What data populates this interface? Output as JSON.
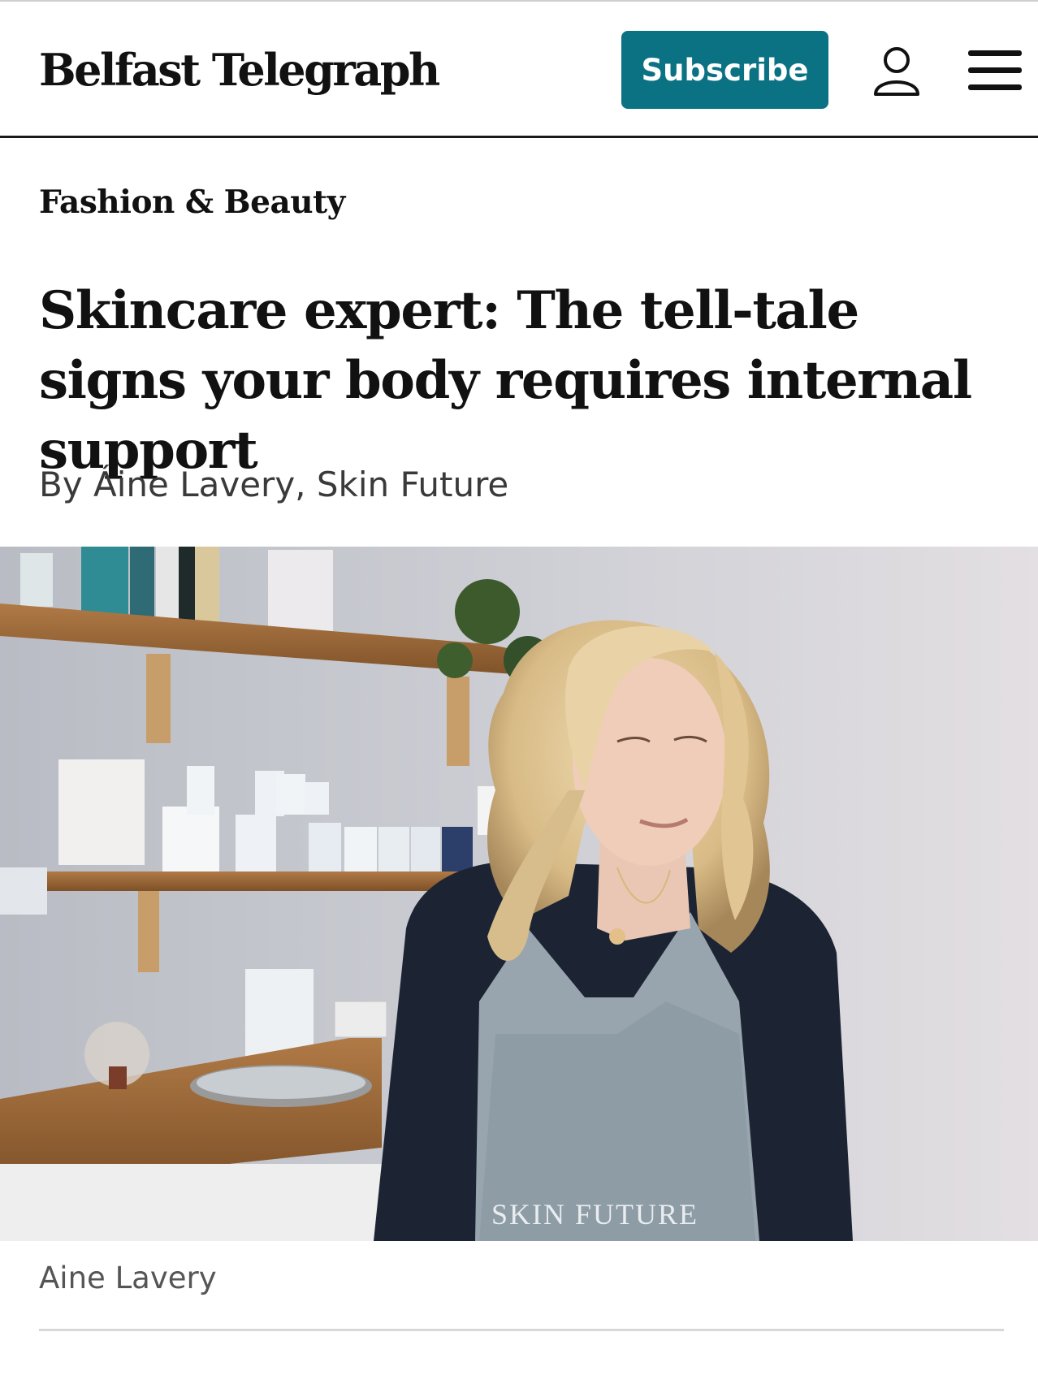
{
  "header": {
    "logo_text": "Belfast Telegraph",
    "subscribe_label": "Subscribe",
    "account_icon": "user-icon",
    "menu_icon": "hamburger-menu-icon"
  },
  "article": {
    "section": "Fashion & Beauty",
    "headline": "Skincare expert: The tell-tale signs your body requires internal support",
    "byline": "By Áine Lavery, Skin Future",
    "image_caption": "Aine Lavery",
    "apron_text": "SKIN FUTURE"
  },
  "colors": {
    "brand_teal": "#0a7282",
    "text": "#111111",
    "secondary_text": "#3a3a3a"
  }
}
